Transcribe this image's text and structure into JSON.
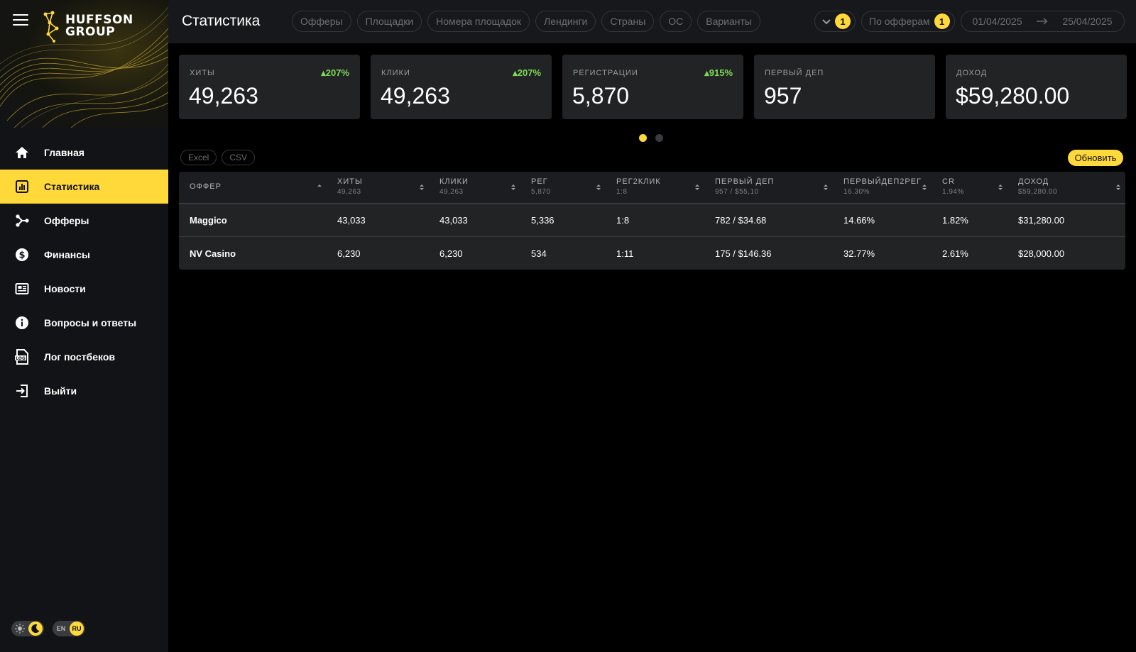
{
  "brand": {
    "line1": "HUFFSON",
    "line2": "GROUP"
  },
  "colors": {
    "accent": "#ffd83a",
    "positive": "#7ed957",
    "sidebar": "#121316",
    "card": "#222325"
  },
  "sidebar": {
    "items": [
      {
        "label": "Главная",
        "icon": "home-icon"
      },
      {
        "label": "Статистика",
        "icon": "bar-chart-icon",
        "active": true
      },
      {
        "label": "Офферы",
        "icon": "share-icon"
      },
      {
        "label": "Финансы",
        "icon": "dollar-icon"
      },
      {
        "label": "Новости",
        "icon": "newspaper-icon"
      },
      {
        "label": "Вопросы и ответы",
        "icon": "info-icon"
      },
      {
        "label": "Лог постбеков",
        "icon": "log-file-icon"
      },
      {
        "label": "Выйти",
        "icon": "logout-icon"
      }
    ],
    "theme_toggle": {
      "selected": "dark"
    },
    "lang_toggle": {
      "en": "EN",
      "ru": "RU",
      "selected": "RU"
    }
  },
  "header": {
    "title": "Статистика",
    "filters": [
      "Офферы",
      "Площадки",
      "Номера площадок",
      "Лендинги",
      "Страны",
      "ОС",
      "Варианты"
    ],
    "columns_badge": "1",
    "group_by": {
      "label": "По офферам",
      "badge": "1"
    },
    "date_from": "01/04/2025",
    "date_to": "25/04/2025"
  },
  "kpis": [
    {
      "label": "Хиты",
      "value": "49,263",
      "delta": "207%"
    },
    {
      "label": "Клики",
      "value": "49,263",
      "delta": "207%"
    },
    {
      "label": "Регистрации",
      "value": "5,870",
      "delta": "915%"
    },
    {
      "label": "Первый деп",
      "value": "957",
      "delta": ""
    },
    {
      "label": "Доход",
      "value": "$59,280.00",
      "delta": ""
    }
  ],
  "carousel": {
    "pages": 2,
    "current": 1
  },
  "exports": {
    "excel": "Excel",
    "csv": "CSV"
  },
  "refresh_label": "Обновить",
  "table": {
    "columns": [
      {
        "name": "Оффер",
        "total": ""
      },
      {
        "name": "Хиты",
        "total": "49,263"
      },
      {
        "name": "Клики",
        "total": "49,263"
      },
      {
        "name": "Рег",
        "total": "5,870"
      },
      {
        "name": "Рег2клик",
        "total": "1:8"
      },
      {
        "name": "Первый деп",
        "total": "957 / $55,10"
      },
      {
        "name": "ПервыйДеп2Рег",
        "total": "16.30%"
      },
      {
        "name": "CR",
        "total": "1.94%"
      },
      {
        "name": "Доход",
        "total": "$59,280.00"
      }
    ],
    "rows": [
      [
        "Maggico",
        "43,033",
        "43,033",
        "5,336",
        "1:8",
        "782 / $34.68",
        "14.66%",
        "1.82%",
        "$31,280.00"
      ],
      [
        "NV Casino",
        "6,230",
        "6,230",
        "534",
        "1:11",
        "175 / $146.36",
        "32.77%",
        "2.61%",
        "$28,000.00"
      ]
    ]
  }
}
